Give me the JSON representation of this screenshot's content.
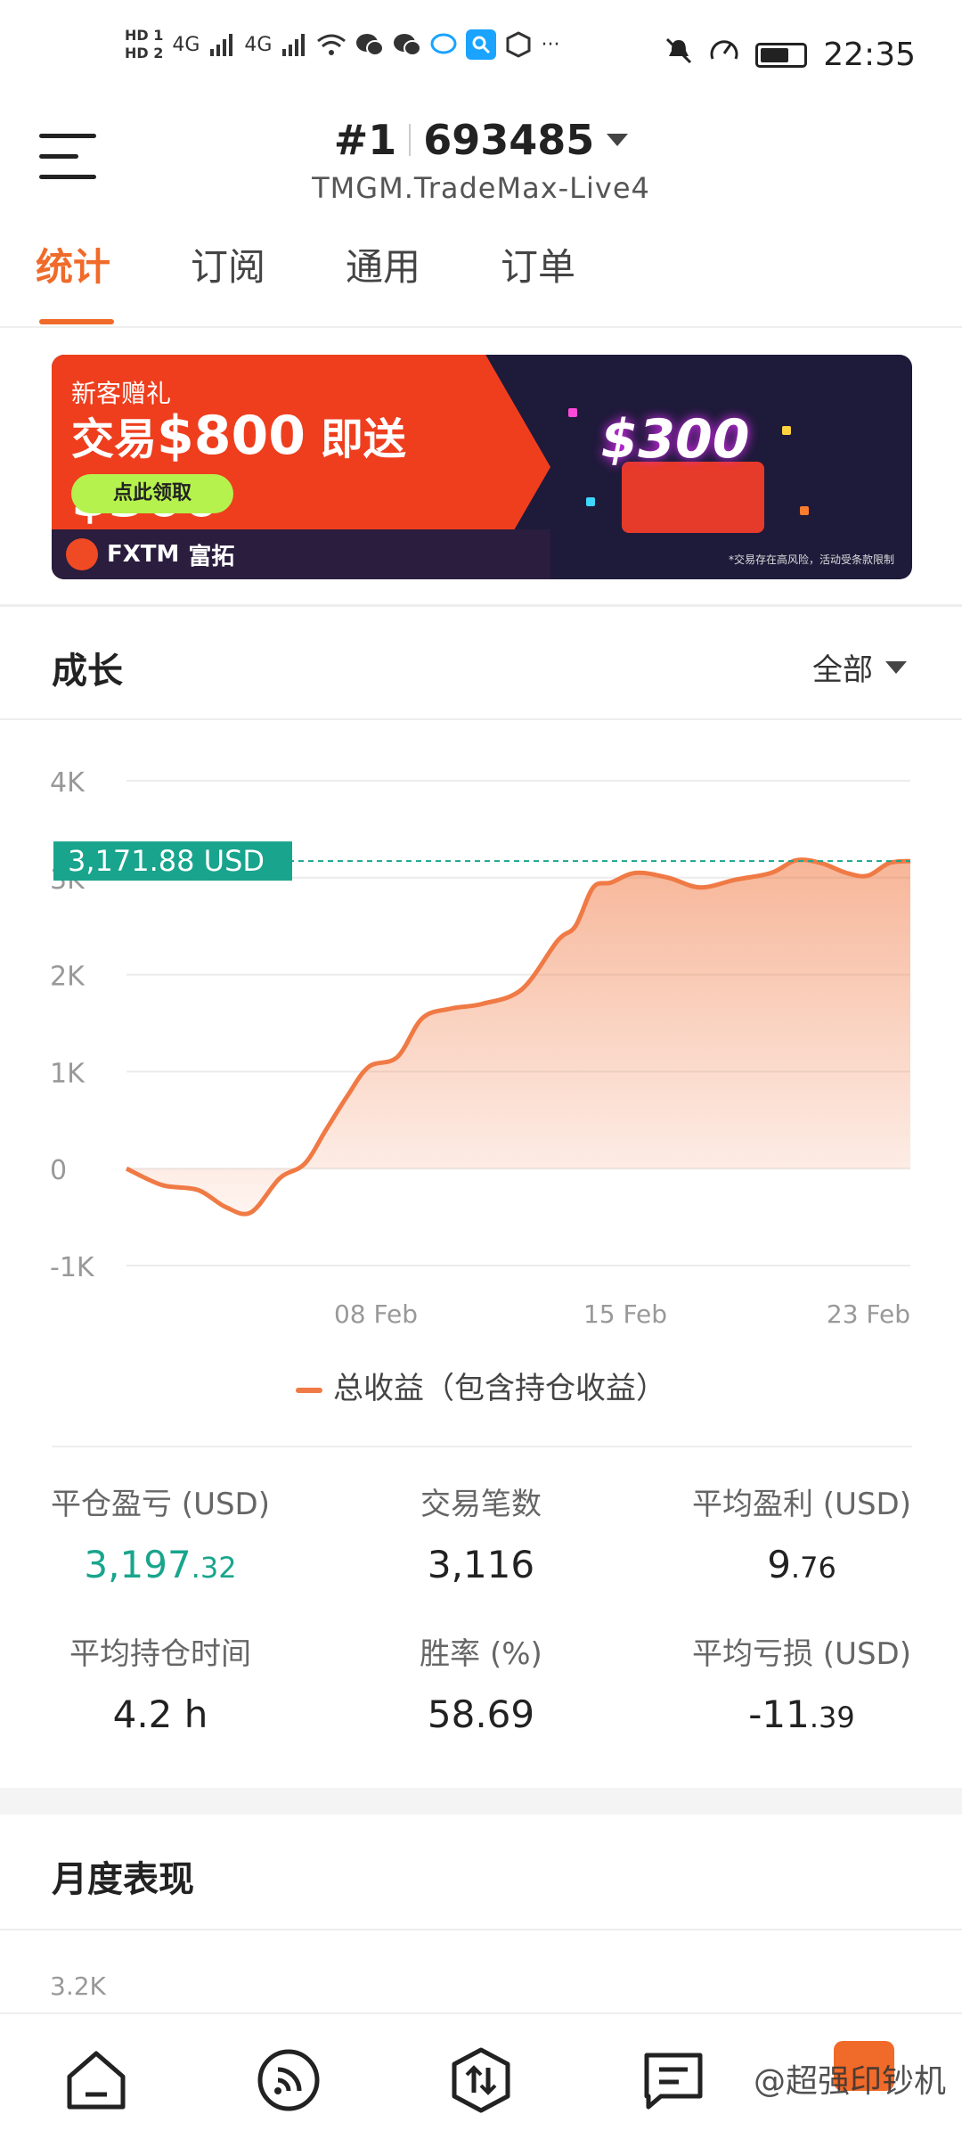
{
  "status_bar": {
    "hd_top": "HD 1",
    "hd_bottom": "HD 2",
    "signal1": "4G",
    "signal2": "4G",
    "more": "···",
    "time": "22:35",
    "icons": [
      "signal-icon",
      "wifi-icon",
      "wechat-icon",
      "wechat-icon",
      "chat-icon",
      "search-app-icon",
      "hand-icon",
      "mute-icon",
      "speed-icon",
      "battery-icon"
    ]
  },
  "header": {
    "rank": "#1",
    "account_id": "693485",
    "server": "TMGM.TradeMax-Live4"
  },
  "tabs": [
    "统计",
    "订阅",
    "通用",
    "订单"
  ],
  "banner": {
    "subtitle": "新客赠礼",
    "headline_prefix": "交易",
    "headline_amount1": "$800",
    "headline_mid": "即送",
    "headline_amount2": "$300",
    "cta": "点此领取",
    "brand": "FXTM",
    "brand_cn": "富拓",
    "gift_amount": "$300",
    "note": "*交易存在高风险，活动受条款限制"
  },
  "growth": {
    "title": "成长",
    "filter": "全部",
    "current_label": "3,171.88 USD",
    "legend": "总收益（包含持仓收益）"
  },
  "chart_data": {
    "type": "area",
    "title": "",
    "xlabel": "",
    "ylabel": "",
    "ylim": [
      -1000,
      4000
    ],
    "yticks": [
      "4K",
      "3K",
      "2K",
      "1K",
      "0",
      "-1K"
    ],
    "ytick_values": [
      4000,
      3000,
      2000,
      1000,
      0,
      -1000
    ],
    "xticks": [
      "08 Feb",
      "15 Feb",
      "23 Feb"
    ],
    "xtick_positions": [
      8,
      15,
      23
    ],
    "xlim": [
      1,
      23
    ],
    "series": [
      {
        "name": "总收益（包含持仓收益）",
        "color": "#f07a45",
        "x": [
          1,
          2,
          3,
          3.8,
          4.5,
          5.3,
          6,
          6.6,
          7.2,
          7.8,
          8.6,
          9.3,
          10.1,
          11,
          12.1,
          13.1,
          13.6,
          14.1,
          14.6,
          15.3,
          16.2,
          17.1,
          18.1,
          19.1,
          19.8,
          20.5,
          21.2,
          21.8,
          22.4,
          23
        ],
        "values": [
          0,
          -170,
          -220,
          -400,
          -450,
          -100,
          50,
          400,
          750,
          1050,
          1150,
          1550,
          1650,
          1700,
          1850,
          2350,
          2500,
          2900,
          2950,
          3050,
          3000,
          2900,
          2980,
          3050,
          3180,
          3150,
          3050,
          3020,
          3150,
          3171.88
        ]
      }
    ],
    "reference_line": 3171.88,
    "grid": true
  },
  "stats": [
    {
      "label": "平仓盈亏 (USD)",
      "value_int": "3,197",
      "value_dec": ".32",
      "color": "#19a58d"
    },
    {
      "label": "交易笔数",
      "value_int": "3,116",
      "value_dec": "",
      "color": "#222222"
    },
    {
      "label": "平均盈利 (USD)",
      "value_int": "9",
      "value_dec": ".76",
      "color": "#222222"
    },
    {
      "label": "平均持仓时间",
      "value_int": "4.2 h",
      "value_dec": "",
      "color": "#222222"
    },
    {
      "label": "胜率 (%)",
      "value_int": "58.69",
      "value_dec": "",
      "color": "#222222"
    },
    {
      "label": "平均亏损 (USD)",
      "value_int": "-11",
      "value_dec": ".39",
      "color": "#222222"
    }
  ],
  "monthly": {
    "title": "月度表现",
    "first_tick": "3.2K"
  },
  "bottom_nav": [
    "home-icon",
    "signal-feed-icon",
    "trade-icon",
    "message-icon",
    "profile-icon"
  ],
  "watermark": "@超强印钞机",
  "colors": {
    "accent": "#f06a2a",
    "positive": "#19a58d",
    "line": "#f07a45"
  }
}
